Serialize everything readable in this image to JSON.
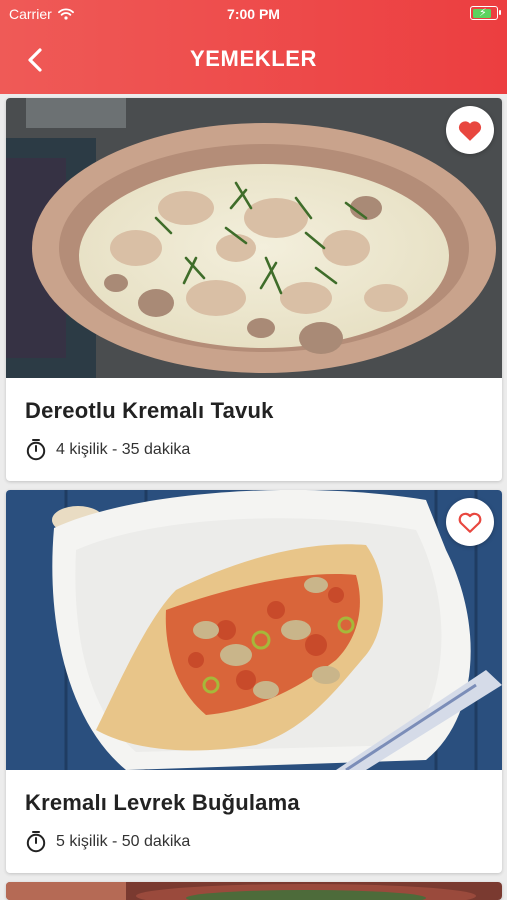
{
  "status": {
    "carrier": "Carrier",
    "time": "7:00 PM",
    "battery_level": 0.85
  },
  "header": {
    "title": "YEMEKLER"
  },
  "icons": {
    "back": "chevron-left-icon",
    "favorite": "heart-icon",
    "timer": "stopwatch-icon",
    "wifi": "wifi-icon",
    "battery": "battery-icon"
  },
  "colors": {
    "header_start": "#ef5a57",
    "header_end": "#ec3e40",
    "favorite": "#e8473f",
    "background": "#ececec"
  },
  "recipes": [
    {
      "title": "Dereotlu Kremalı Tavuk",
      "meta": "4 kişilik - 35 dakika",
      "favorite": true
    },
    {
      "title": "Kremalı Levrek Buğulama",
      "meta": "5 kişilik - 50 dakika",
      "favorite": false
    },
    {
      "title": "",
      "meta": "",
      "favorite": false
    }
  ]
}
